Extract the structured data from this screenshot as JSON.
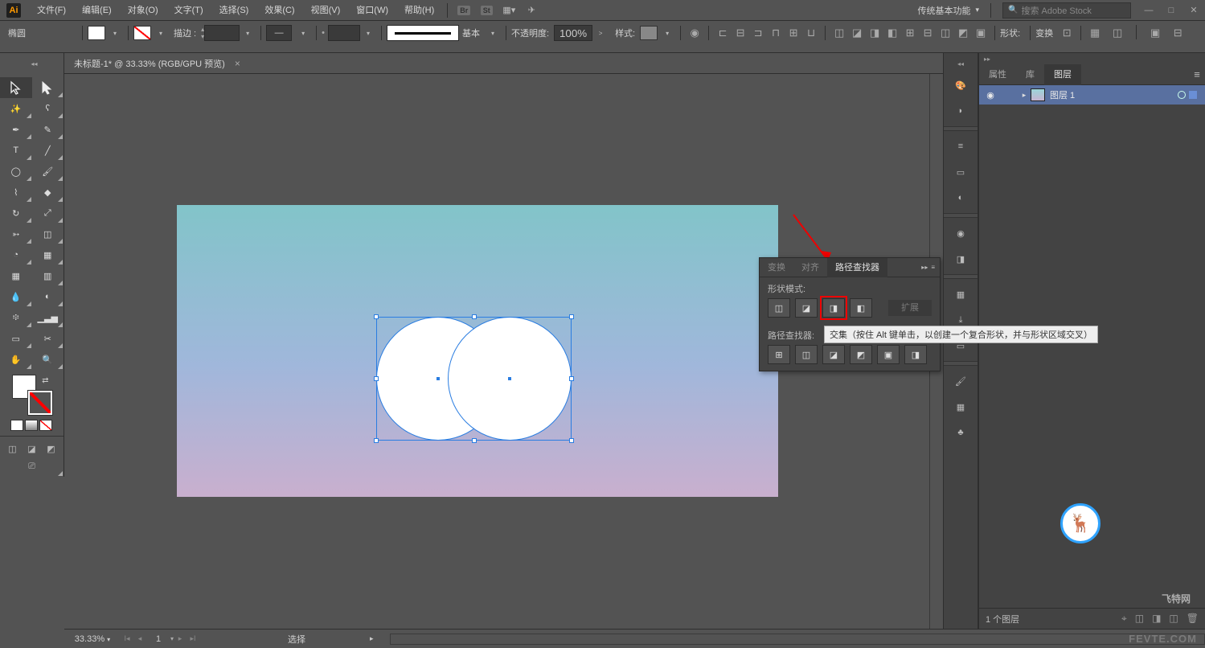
{
  "app": {
    "logo": "Ai"
  },
  "menu": {
    "file": "文件(F)",
    "edit": "编辑(E)",
    "object": "对象(O)",
    "type": "文字(T)",
    "select": "选择(S)",
    "effect": "效果(C)",
    "view": "视图(V)",
    "window": "窗口(W)",
    "help": "帮助(H)",
    "br": "Br",
    "st": "St"
  },
  "workspace": {
    "label": "传统基本功能"
  },
  "search": {
    "placeholder": "搜索 Adobe Stock"
  },
  "control": {
    "shapeName": "椭圆",
    "strokeLabel": "描边 :",
    "strokeWidth": "",
    "brushLabel": "基本",
    "opacityLabel": "不透明度:",
    "opacityValue": "100%",
    "styleLabel": "样式:",
    "shapeBtn": "形状:",
    "transformBtn": "变换"
  },
  "document": {
    "tabTitle": "未标题-1* @ 33.33% (RGB/GPU 预览)"
  },
  "pathfinder": {
    "tabTransform": "变换",
    "tabAlign": "对齐",
    "tabPathfinder": "路径查找器",
    "shapeModesLabel": "形状模式:",
    "pathfindersLabel": "路径查找器:",
    "expand": "扩展"
  },
  "tooltip": {
    "intersect": "交集（按住 Alt 键单击，以创建一个复合形状，并与形状区域交叉）"
  },
  "layers": {
    "tabProps": "属性",
    "tabLib": "库",
    "tabLayers": "图层",
    "layer1": "图层 1",
    "footer": "1 个图层"
  },
  "status": {
    "zoom": "33.33%",
    "artboardNum": "1",
    "tool": "选择"
  },
  "watermark": {
    "site": "飞特网",
    "url": "FEVTE.COM"
  },
  "icons": {
    "search": "🔍",
    "min": "—",
    "max": "□",
    "close": "✕",
    "dropdown": "▾",
    "right": "▸",
    "left": "◂",
    "first": "I◂",
    "last": "▸I",
    "eye": "👁",
    "trash": "🗑",
    "newlayer": "◫",
    "menu": "≡"
  }
}
